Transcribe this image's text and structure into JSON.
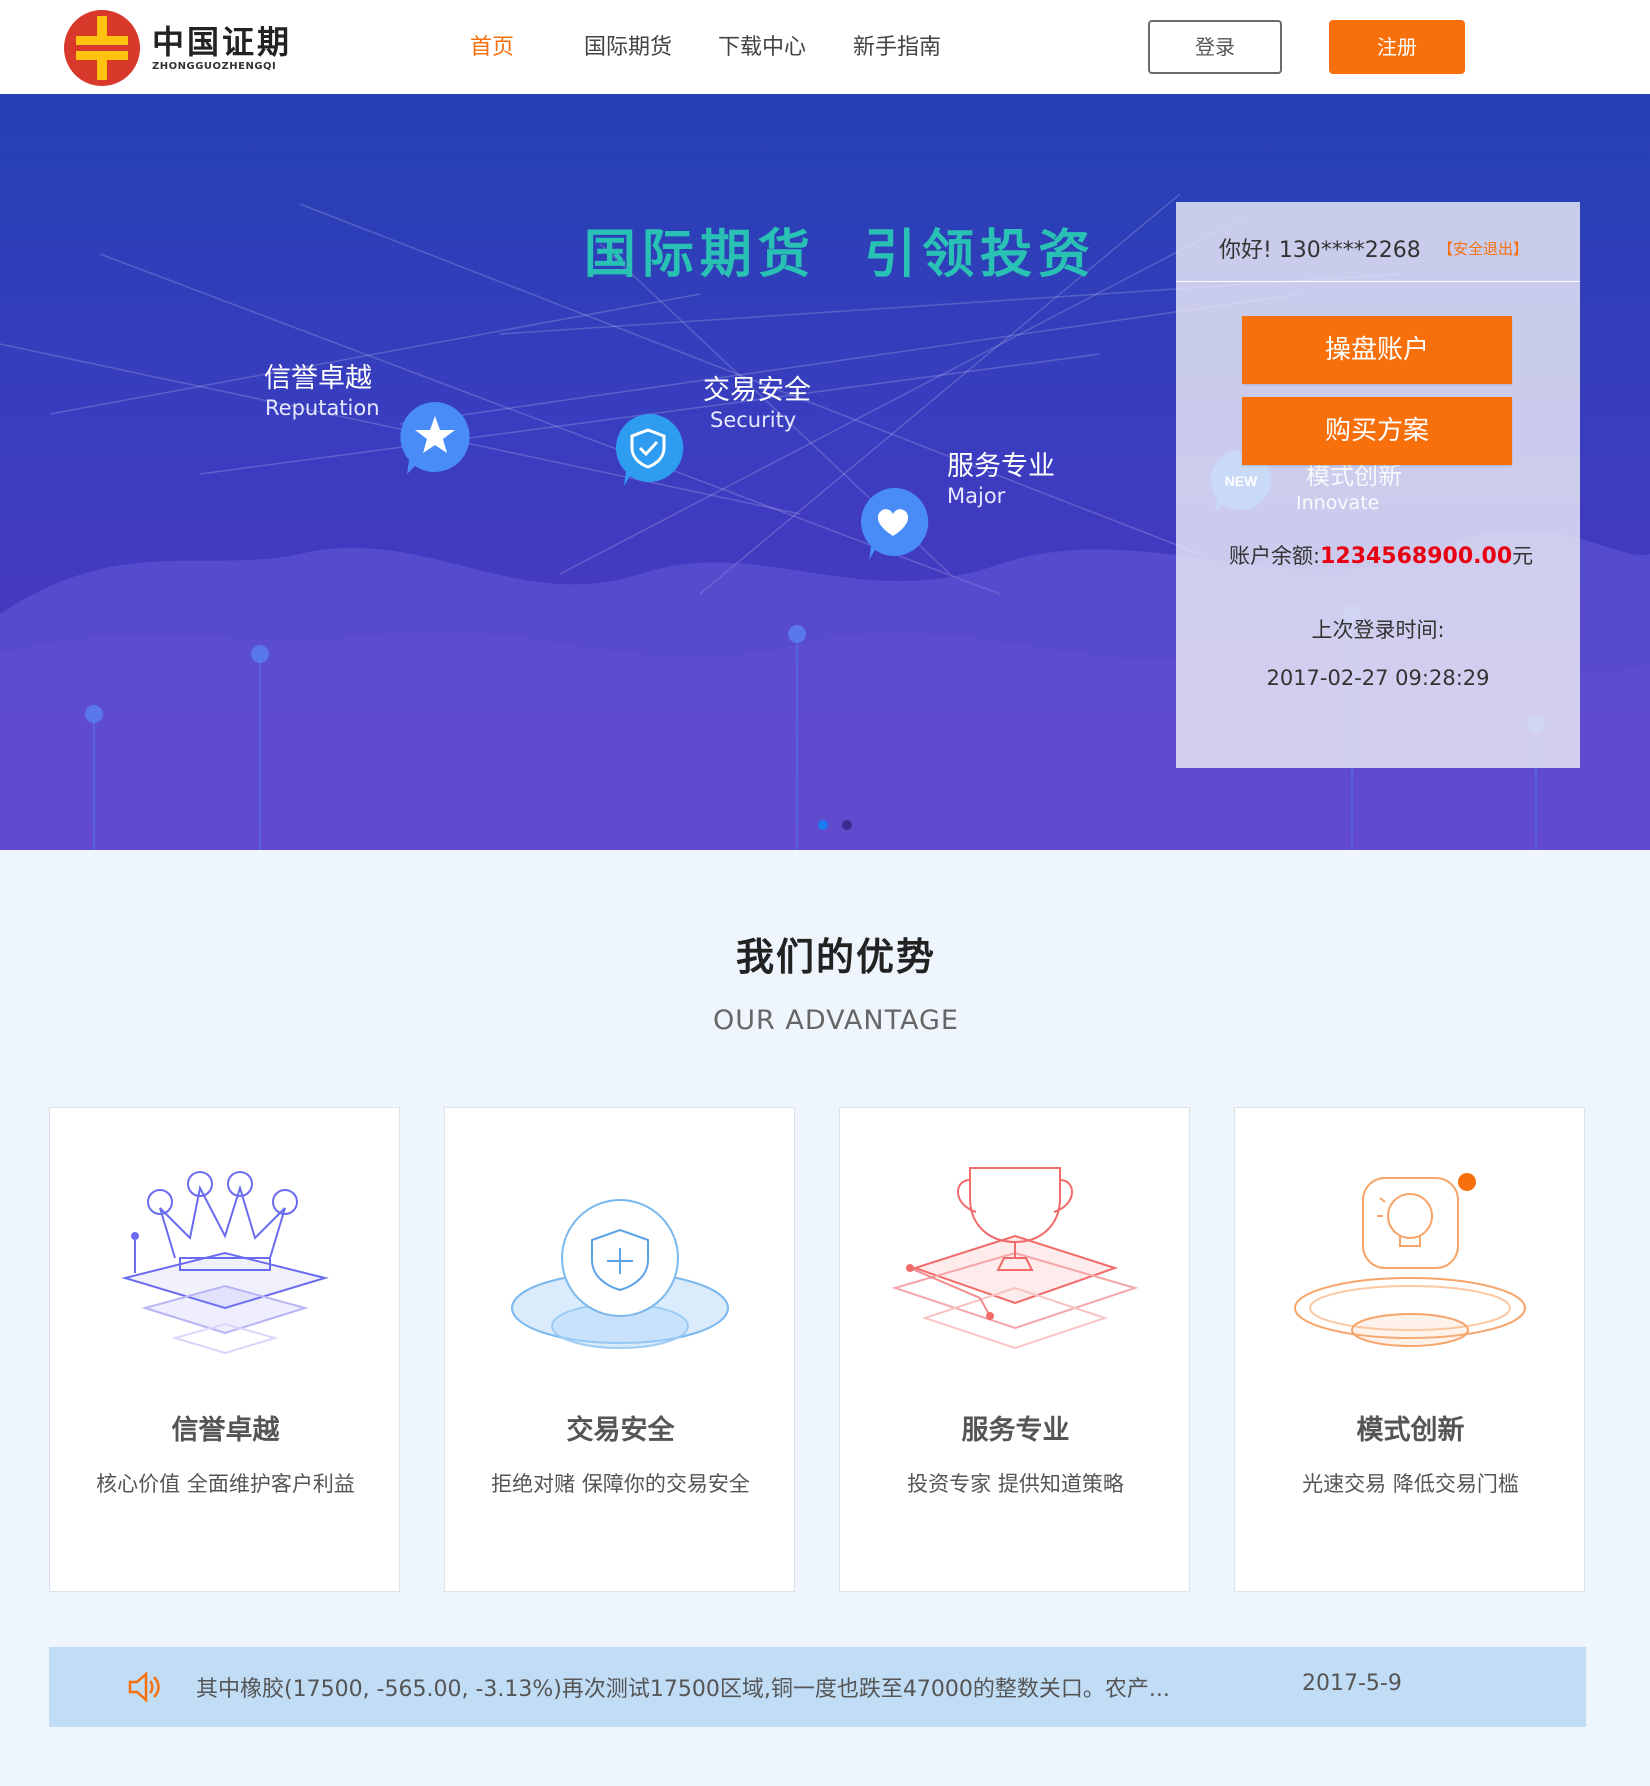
{
  "brand": {
    "name_cn": "中国证期",
    "name_en": "ZHONGGUOZHENGQI",
    "colors": {
      "accent": "#f7700b",
      "logo_red": "#d8392b",
      "logo_yellow": "#ffc20e"
    }
  },
  "nav": {
    "items": [
      {
        "label": "首页",
        "active": true
      },
      {
        "label": "国际期货",
        "active": false
      },
      {
        "label": "下载中心",
        "active": false
      },
      {
        "label": "新手指南",
        "active": false
      }
    ],
    "login_label": "登录",
    "register_label": "注册"
  },
  "banner": {
    "title": "国际期货  引领投资",
    "features": [
      {
        "cn": "信誉卓越",
        "en": "Reputation",
        "icon": "star-icon"
      },
      {
        "cn": "交易安全",
        "en": "Security",
        "icon": "shield-check-icon"
      },
      {
        "cn": "服务专业",
        "en": "Major",
        "icon": "heart-icon"
      },
      {
        "cn": "模式创新",
        "en": "Innovate",
        "icon": "new-badge-icon",
        "badge": "NEW"
      }
    ],
    "slides": 2,
    "active_slide": 1
  },
  "account": {
    "greeting": "你好!  130****2268",
    "logout_label": "【安全退出】",
    "trading_account_label": "操盘账户",
    "buy_plan_label": "购买方案",
    "balance_label": "账户余额:",
    "balance_value": "1234568900.00",
    "balance_unit": "元",
    "last_login_label": "上次登录时间:",
    "last_login_time": "2017-02-27 09:28:29"
  },
  "advantage": {
    "title": "我们的优势",
    "subtitle": "OUR ADVANTAGE",
    "cards": [
      {
        "title": "信誉卓越",
        "desc": "核心价值 全面维护客户利益",
        "icon": "crown-icon"
      },
      {
        "title": "交易安全",
        "desc": "拒绝对赌 保障你的交易安全",
        "icon": "shield-plus-icon"
      },
      {
        "title": "服务专业",
        "desc": "投资专家 提供知道策略",
        "icon": "trophy-icon"
      },
      {
        "title": "模式创新",
        "desc": "光速交易 降低交易门槛",
        "icon": "lightbulb-icon"
      }
    ]
  },
  "news": {
    "icon": "speaker-icon",
    "text": "其中橡胶(17500, -565.00, -3.13%)再次测试17500区域,铜一度也跌至47000的整数关口。农产...",
    "date": "2017-5-9"
  }
}
